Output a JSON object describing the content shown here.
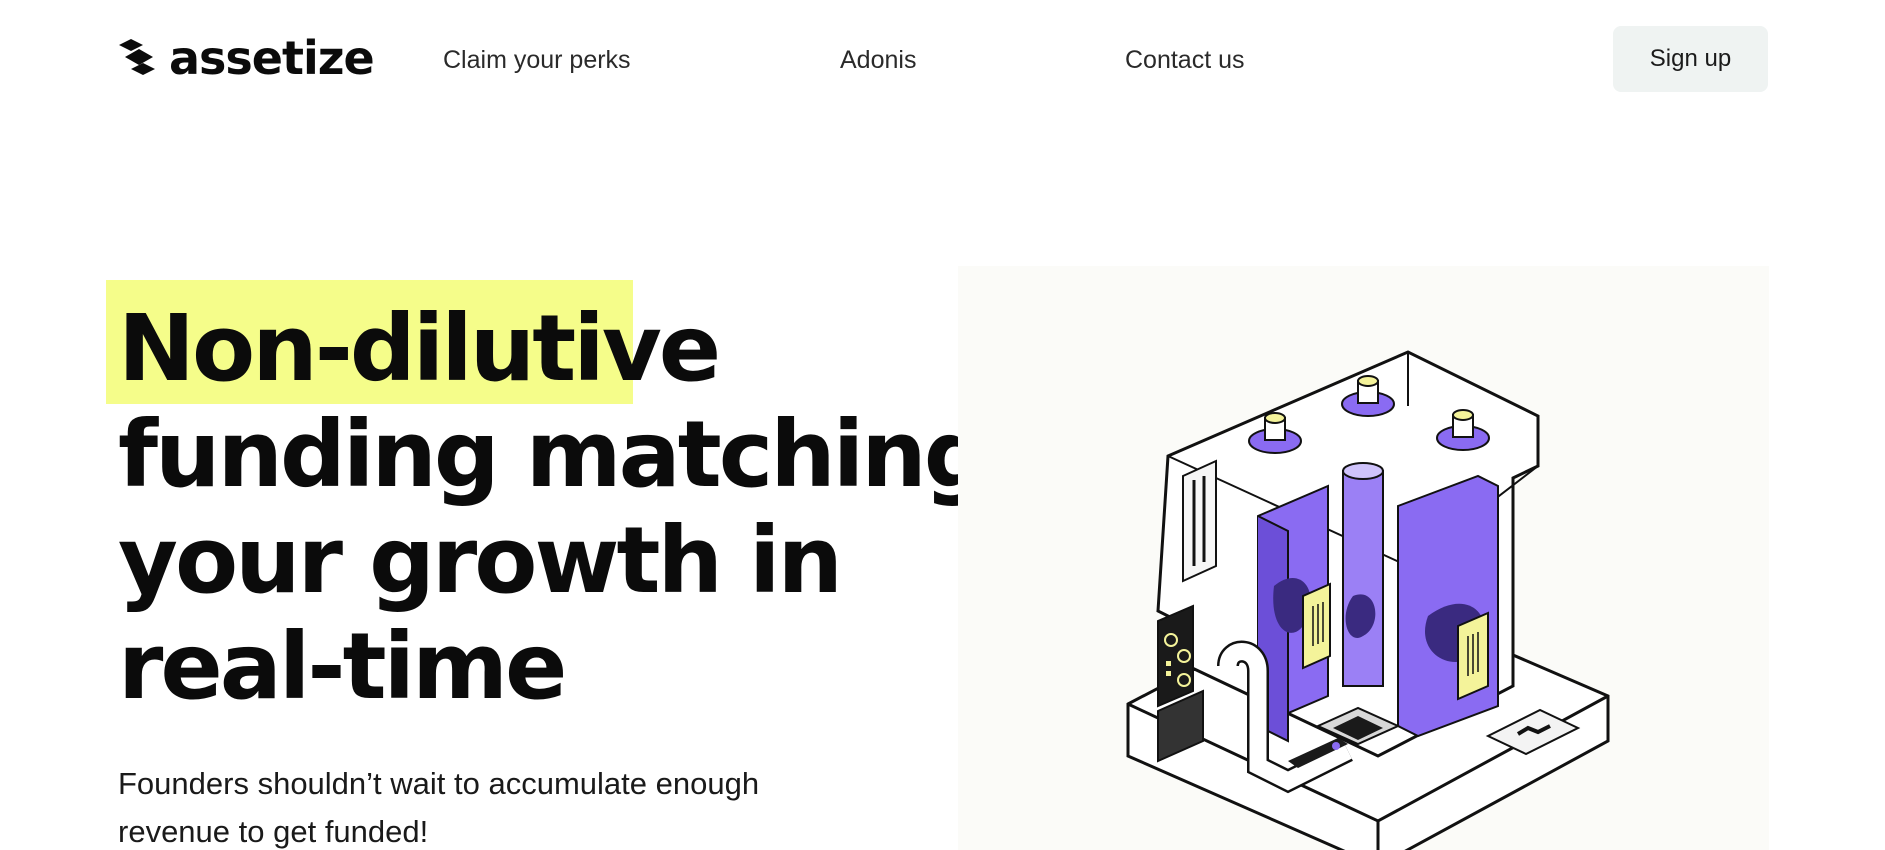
{
  "brand": {
    "name": "assetize"
  },
  "nav": {
    "links": [
      "Claim your perks",
      "Adonis",
      "Contact us"
    ],
    "signup_label": "Sign up"
  },
  "hero": {
    "headline_lines": [
      "Non-dilutive",
      "funding matching",
      "your growth in",
      "real-time"
    ],
    "subtext": "Founders shouldn’t wait to accumulate enough revenue to get funded!"
  },
  "colors": {
    "highlight": "#f5fd8a",
    "signup_bg": "#eff3f2",
    "tank_purple": "#8a6bf2",
    "label_yellow": "#f4f39a"
  },
  "illustration": {
    "icon": "funding-machine-illustration"
  }
}
